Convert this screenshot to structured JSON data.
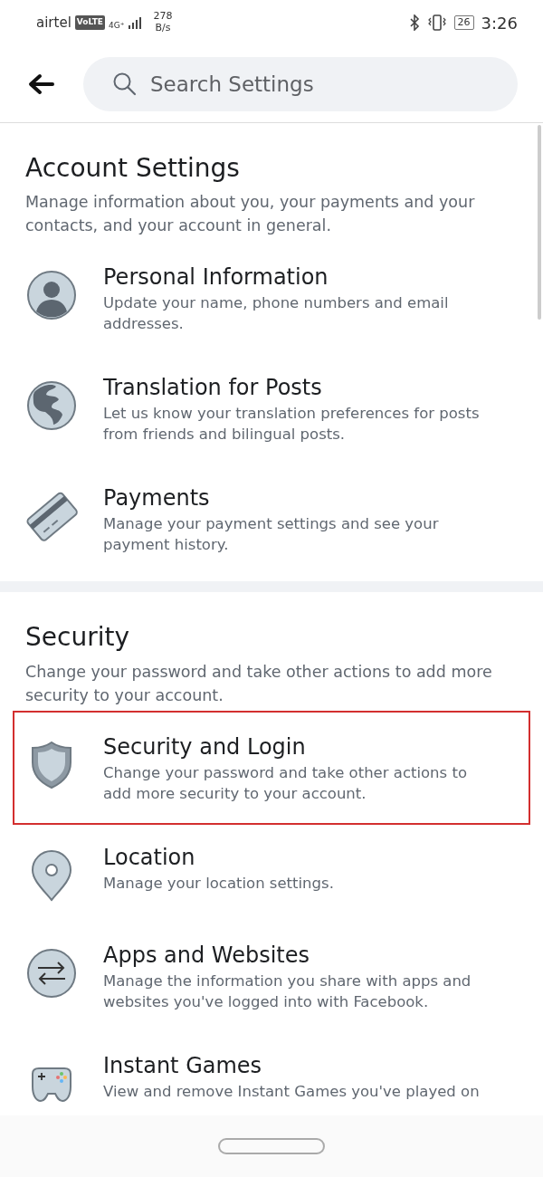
{
  "status_bar": {
    "carrier": "airtel",
    "volte": "VoLTE",
    "network": "4G⁺",
    "speed_value": "278",
    "speed_unit": "B/s",
    "battery": "26",
    "time": "3:26"
  },
  "search": {
    "placeholder": "Search Settings"
  },
  "sections": [
    {
      "title": "Account Settings",
      "description": "Manage information about you, your payments and your contacts, and your account in general.",
      "items": [
        {
          "kind": "person",
          "title": "Personal Information",
          "description": "Update your name, phone numbers and email addresses.",
          "highlighted": false
        },
        {
          "kind": "globe",
          "title": "Translation for Posts",
          "description": "Let us know your translation preferences for posts from friends and bilingual posts.",
          "highlighted": false
        },
        {
          "kind": "card",
          "title": "Payments",
          "description": "Manage your payment settings and see your payment history.",
          "highlighted": false
        }
      ]
    },
    {
      "title": "Security",
      "description": "Change your password and take other actions to add more security to your account.",
      "items": [
        {
          "kind": "shield",
          "title": "Security and Login",
          "description": "Change your password and take other actions to add more security to your account.",
          "highlighted": true
        },
        {
          "kind": "pin",
          "title": "Location",
          "description": "Manage your location settings.",
          "highlighted": false
        },
        {
          "kind": "arrows",
          "title": "Apps and Websites",
          "description": "Manage the information you share with apps and websites you've logged into with Facebook.",
          "highlighted": false
        },
        {
          "kind": "gamepad",
          "title": "Instant Games",
          "description": "View and remove Instant Games you've played on",
          "highlighted": false
        }
      ]
    }
  ]
}
